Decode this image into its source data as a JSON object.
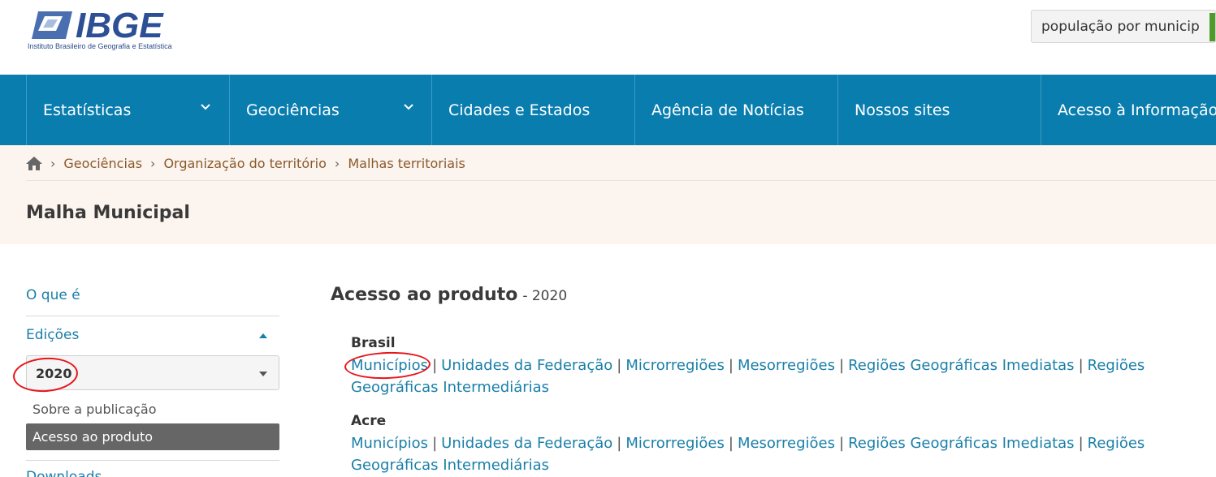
{
  "header": {
    "logo_text": "IBGE",
    "logo_subtitle": "Instituto Brasileiro de Geografia e Estatística",
    "search_value": "população por municip"
  },
  "nav": {
    "items": [
      {
        "label": "Estatísticas",
        "has_dropdown": true
      },
      {
        "label": "Geociências",
        "has_dropdown": true
      },
      {
        "label": "Cidades e Estados",
        "has_dropdown": false
      },
      {
        "label": "Agência de Notícias",
        "has_dropdown": false
      },
      {
        "label": "Nossos sites",
        "has_dropdown": false
      },
      {
        "label": "Acesso à Informação",
        "has_dropdown": false
      }
    ]
  },
  "breadcrumb": {
    "home_icon": "home-icon",
    "items": [
      "Geociências",
      "Organização do território",
      "Malhas territoriais"
    ]
  },
  "page_title": "Malha Municipal",
  "sidebar": {
    "o_que_e": "O que é",
    "edicoes": "Edições",
    "edition_selected": "2020",
    "sobre": "Sobre a publicação",
    "acesso": "Acesso ao produto",
    "cut_item": "Downloads"
  },
  "main": {
    "title": "Acesso ao produto",
    "year": "- 2020",
    "regions": [
      {
        "name": "Brasil",
        "links": [
          "Municípios",
          "Unidades da Federação",
          "Microrregiões",
          "Mesorregiões",
          "Regiões Geográficas Imediatas",
          "Regiões Geográficas Intermediárias"
        ]
      },
      {
        "name": "Acre",
        "links": [
          "Municípios",
          "Unidades da Federação",
          "Microrregiões",
          "Mesorregiões",
          "Regiões Geográficas Imediatas",
          "Regiões Geográficas Intermediárias"
        ]
      }
    ],
    "separator": "|"
  },
  "colors": {
    "nav_bg": "#0a7daf",
    "band_bg": "#fcf4ee",
    "link": "#1a7fa8",
    "annotation": "#e8141a",
    "search_accent": "#4e9a2a"
  }
}
